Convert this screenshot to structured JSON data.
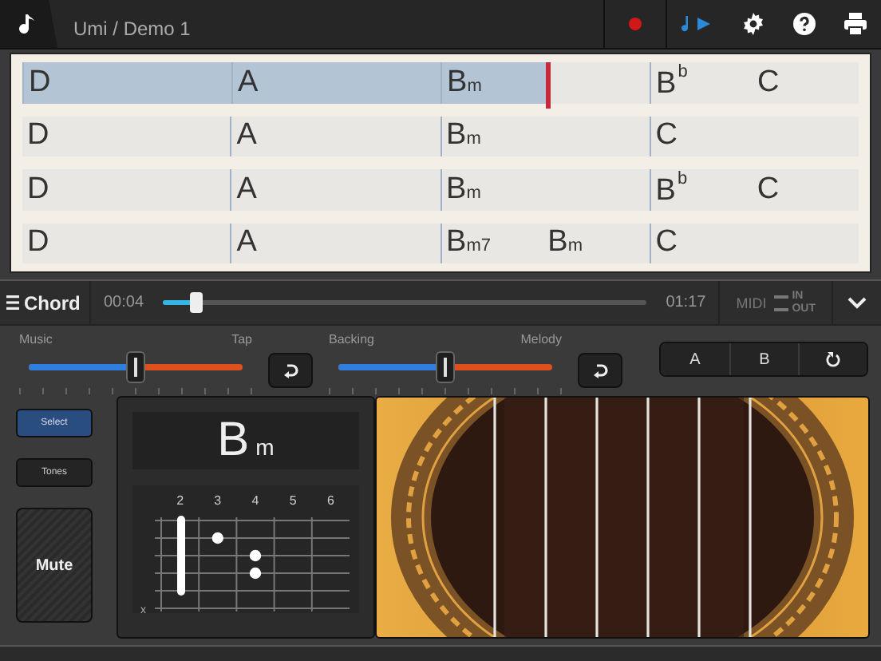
{
  "top_bar": {
    "title": "Umi / Demo 1",
    "record_on": true
  },
  "chord_sheet": {
    "rows": [
      {
        "selected": true,
        "level": 0.625,
        "bars": [
          [
            "D"
          ],
          [
            "A"
          ],
          [
            "B$_{m}$"
          ],
          [
            "B$^{b}$",
            "C"
          ]
        ]
      },
      {
        "selected": false,
        "bars": [
          [
            "D"
          ],
          [
            "A"
          ],
          [
            "B$_{m}$"
          ],
          [
            "C"
          ]
        ]
      },
      {
        "selected": false,
        "bars": [
          [
            "D"
          ],
          [
            "A"
          ],
          [
            "B$_{m}$"
          ],
          [
            "B$^{b}$",
            "C"
          ]
        ]
      },
      {
        "selected": false,
        "bars": [
          [
            "D"
          ],
          [
            "A"
          ],
          [
            "B$_{m7}$",
            "B$_{m}$"
          ],
          [
            "C"
          ]
        ]
      }
    ]
  },
  "transport": {
    "mode": "Chord",
    "time": "00:04",
    "duration": "01:17",
    "level": 0.07,
    "midi": "MIDI",
    "midi_in": "IN",
    "midi_out": "OUT"
  },
  "mixers": [
    {
      "left": "Music",
      "right": "Tap",
      "level": 0.5
    },
    {
      "left": "Backing",
      "right": "Melody",
      "level": 0.5
    }
  ],
  "sections": [
    {
      "kind": "text",
      "label": "A"
    },
    {
      "kind": "text",
      "label": "B"
    },
    {
      "kind": "reset"
    }
  ],
  "side_buttons": [
    {
      "label": "Select",
      "selected": true
    },
    {
      "label": "Tones",
      "selected": false
    }
  ],
  "mute_button": "Mute",
  "chord": {
    "name": "B$_{m}$",
    "frets": [
      "2",
      "3",
      "4",
      "5",
      "6"
    ],
    "muted_marker": "x"
  }
}
